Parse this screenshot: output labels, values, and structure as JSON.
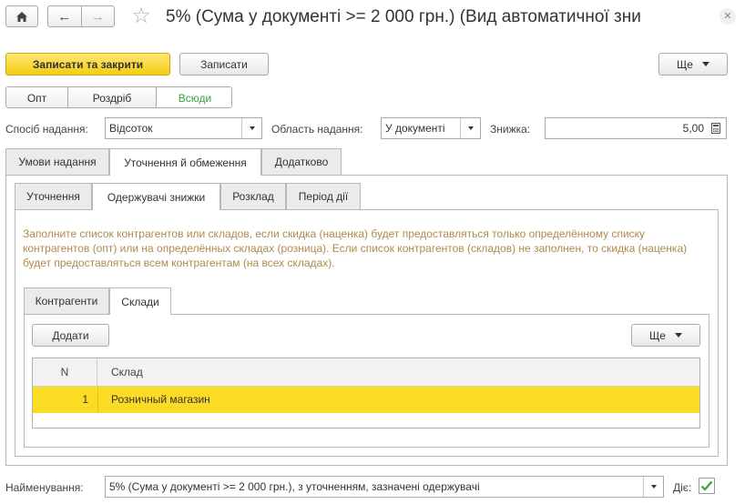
{
  "window": {
    "title": "5% (Сума у документі >= 2 000 грн.) (Вид автоматичної зни"
  },
  "toolbar": {
    "save_close_label": "Записати та закрити",
    "save_label": "Записати",
    "more_label": "Ще"
  },
  "segments": {
    "items": [
      "Опт",
      "Роздріб",
      "Всюди"
    ],
    "selected": "Всюди",
    "selected_color": "#3aa33a"
  },
  "fields": {
    "method_label": "Спосіб надання:",
    "method_value": "Відсоток",
    "area_label": "Область надання:",
    "area_value": "У документі",
    "discount_label": "Знижка:",
    "discount_value": "5,00"
  },
  "main_tabs": [
    {
      "label": "Умови надання"
    },
    {
      "label": "Уточнення й обмеження"
    },
    {
      "label": "Додатково"
    }
  ],
  "sub_tabs": [
    {
      "label": "Уточнення"
    },
    {
      "label": "Одержувачі знижки"
    },
    {
      "label": "Розклад"
    },
    {
      "label": "Період дії"
    }
  ],
  "info_text": "Заполните список контрагентов или складов, если скидка (наценка) будет предоставляться только определённому списку контрагентов (опт) или на определённых складах (розница). Если список контрагентов (складов) не заполнен, то скидка (наценка) будет предоставляться всем контрагентам (на всех складах).",
  "inner_tabs": [
    {
      "label": "Контрагенти"
    },
    {
      "label": "Склади"
    }
  ],
  "table": {
    "add_label": "Додати",
    "more_label": "Ще",
    "columns": [
      "N",
      "Склад"
    ],
    "rows": [
      {
        "n": "1",
        "store": "Розничный магазин"
      }
    ]
  },
  "footer": {
    "name_label": "Найменування:",
    "name_value": "5% (Сума у документі >= 2 000 грн.), з уточненням, зазначені одержувачі",
    "active_label": "Діє:",
    "active_checked": true
  },
  "colors": {
    "accent_yellow": "#f9d923",
    "info_text": "#b08a4a",
    "check_green": "#3aa33a"
  }
}
